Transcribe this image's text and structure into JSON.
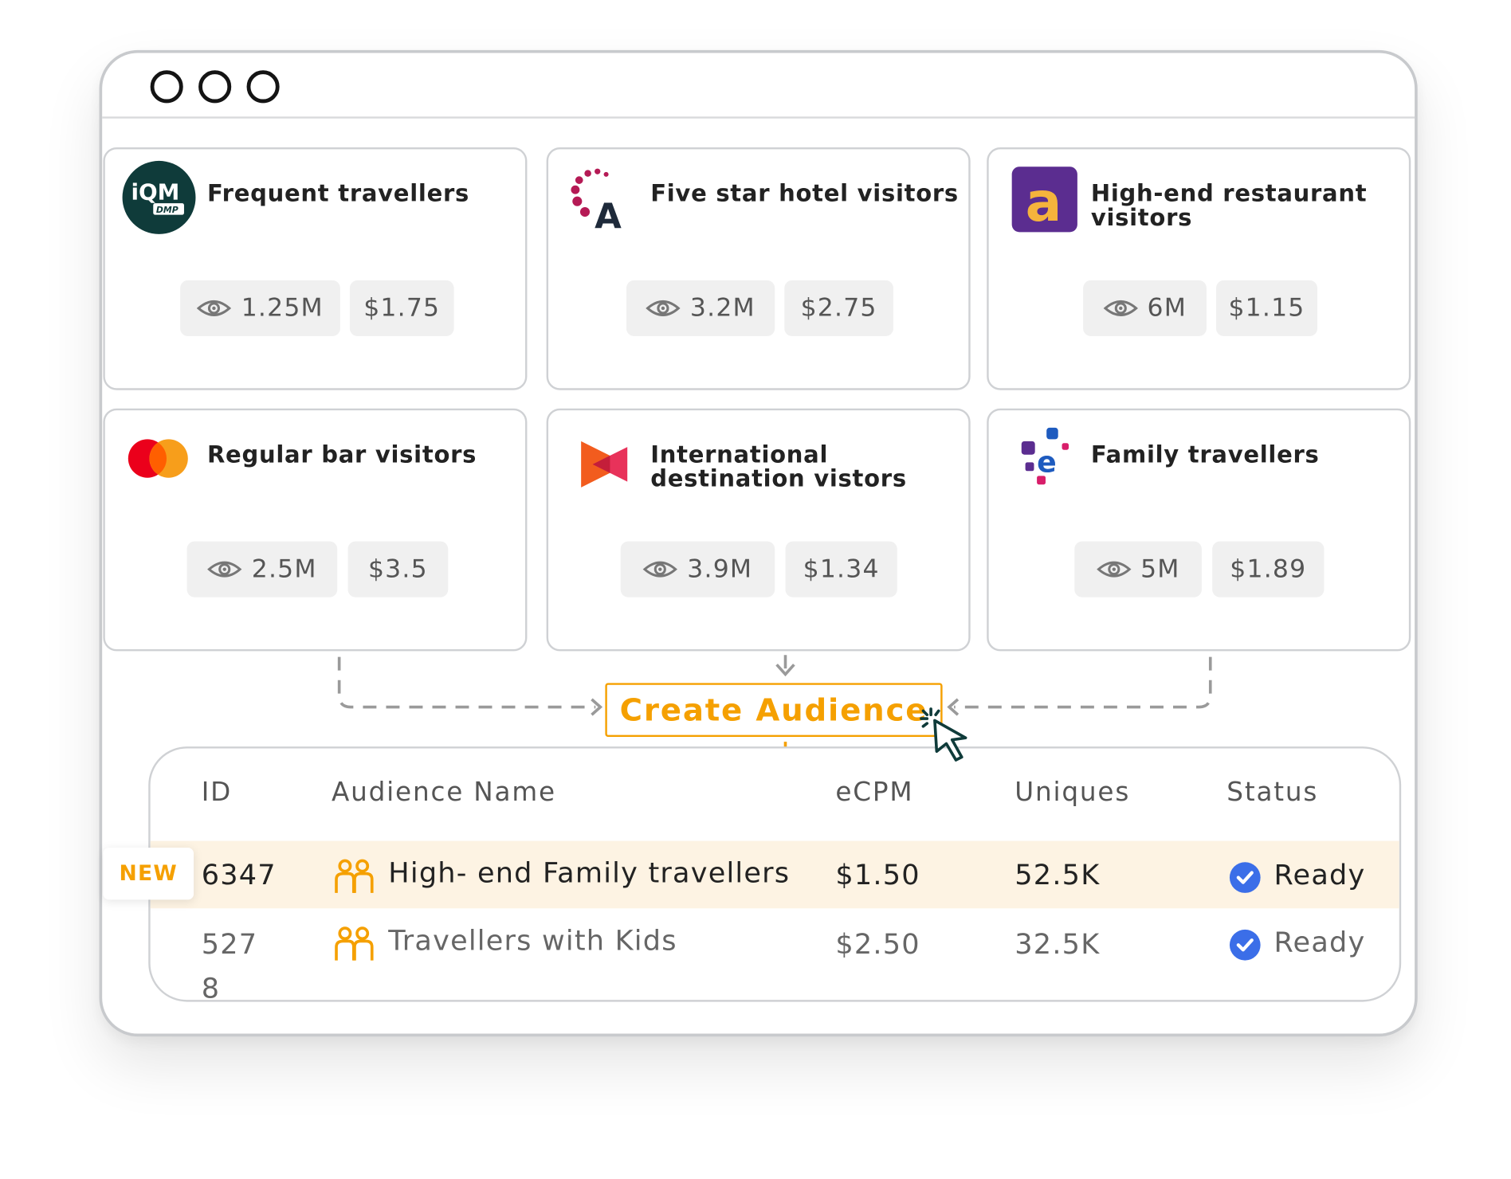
{
  "window": {
    "controls": [
      "circle-1",
      "circle-2",
      "circle-3"
    ]
  },
  "cards": [
    {
      "title": "Frequent travellers",
      "logo": "iqm-dmp-logo",
      "uniques": "1.25M",
      "price": "$1.75"
    },
    {
      "title": "Five star hotel visitors",
      "logo": "accor-logo",
      "uniques": "3.2M",
      "price": "$2.75"
    },
    {
      "title": "High-end restaurant\nvisitors",
      "logo": "a-letter-logo",
      "uniques": "6M",
      "price": "$1.15"
    },
    {
      "title": "Regular bar visitors",
      "logo": "mastercard-logo",
      "uniques": "2.5M",
      "price": "$3.5"
    },
    {
      "title": "International\ndestination vistors",
      "logo": "play-arrow-logo",
      "uniques": "3.9M",
      "price": "$1.34"
    },
    {
      "title": "Family travellers",
      "logo": "e-dots-logo",
      "uniques": "5M",
      "price": "$1.89"
    }
  ],
  "actions": {
    "create_label": "Create Audience"
  },
  "table": {
    "headers": {
      "id": "ID",
      "name": "Audience Name",
      "ecpm": "eCPM",
      "uniques": "Uniques",
      "status": "Status"
    },
    "rows": [
      {
        "badge": "NEW",
        "id": "6347",
        "name": "High- end Family travellers",
        "ecpm": "$1.50",
        "uniques": "52.5K",
        "status": "Ready"
      },
      {
        "id_line1": "527",
        "id_line2": "8",
        "name": "Travellers with Kids",
        "ecpm": "$2.50",
        "uniques": "32.5K",
        "status": "Ready"
      }
    ]
  },
  "colors": {
    "accent": "#f5a000",
    "highlight_row": "#fdf3e3",
    "check": "#3b6ee8",
    "border": "#cfd1d4"
  }
}
